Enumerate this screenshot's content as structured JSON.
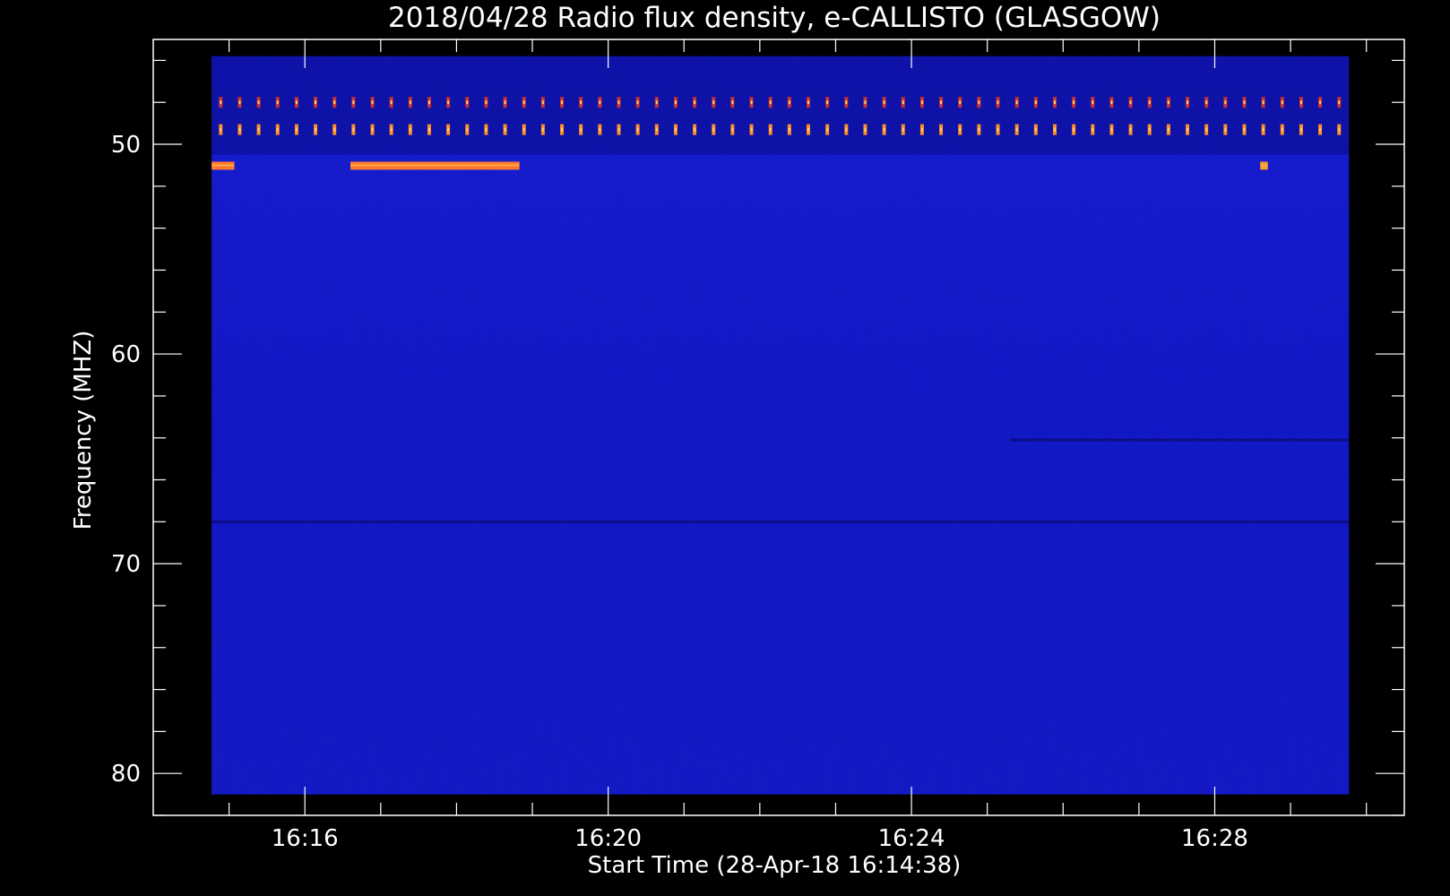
{
  "chart_data": {
    "type": "heatmap",
    "title": "2018/04/28  Radio flux density, e-CALLISTO (GLASGOW)",
    "xlabel": "Start Time (28-Apr-18 16:14:38)",
    "ylabel": "Frequency (MHZ)",
    "x_tick_labels": [
      "16:16",
      "16:20",
      "16:24",
      "16:28"
    ],
    "x_tick_minutes": [
      16.0,
      20.0,
      24.0,
      28.0
    ],
    "xlim_minutes": [
      14.0,
      30.5
    ],
    "y_tick_labels": [
      "50",
      "60",
      "70",
      "80"
    ],
    "y_ticks": [
      50,
      60,
      70,
      80
    ],
    "ylim": [
      45,
      82
    ],
    "y_inverted": true,
    "data_extent": {
      "x_minutes": [
        14.77,
        29.77
      ],
      "freq_mhz": [
        45.8,
        81.0
      ]
    },
    "background_color": "#1414c8",
    "features": [
      {
        "kind": "periodic-interference",
        "freq_mhz": 48.0,
        "period_min": 0.25,
        "x_minutes": [
          14.77,
          29.77
        ],
        "color": "#c83232"
      },
      {
        "kind": "periodic-interference",
        "freq_mhz": 49.3,
        "period_min": 0.25,
        "x_minutes": [
          14.77,
          29.77
        ],
        "color": "#ff8c28"
      },
      {
        "kind": "strong-band",
        "freq_mhz": 51.0,
        "x_minutes": [
          14.77,
          15.07
        ],
        "color": "#ff7832"
      },
      {
        "kind": "strong-band",
        "freq_mhz": 51.0,
        "x_minutes": [
          16.6,
          18.83
        ],
        "color": "#ff7832"
      },
      {
        "kind": "strong-band",
        "freq_mhz": 51.0,
        "x_minutes": [
          28.6,
          28.7
        ],
        "color": "#ff9632"
      },
      {
        "kind": "dark-band",
        "freq_mhz": 64.1,
        "x_minutes": [
          25.3,
          29.77
        ]
      },
      {
        "kind": "dark-band",
        "freq_mhz": 68.0,
        "x_minutes": [
          14.77,
          29.77
        ]
      }
    ]
  }
}
